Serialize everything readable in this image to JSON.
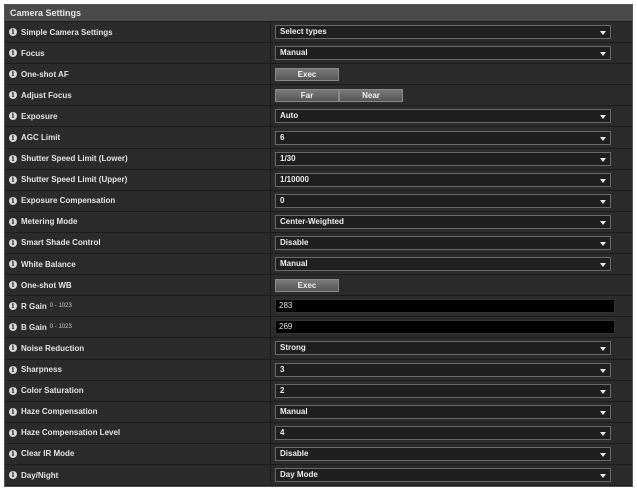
{
  "panel": {
    "title": "Camera Settings"
  },
  "rows": [
    {
      "label": "Simple Camera Settings",
      "control": "select",
      "value": "Select types"
    },
    {
      "label": "Focus",
      "control": "select",
      "value": "Manual"
    },
    {
      "label": "One-shot AF",
      "control": "button",
      "buttons": [
        "Exec"
      ]
    },
    {
      "label": "Adjust Focus",
      "control": "button",
      "buttons": [
        "Far",
        "Near"
      ]
    },
    {
      "label": "Exposure",
      "control": "select",
      "value": "Auto"
    },
    {
      "label": "AGC Limit",
      "control": "select",
      "value": "6"
    },
    {
      "label": "Shutter Speed Limit (Lower)",
      "control": "select",
      "value": "1/30"
    },
    {
      "label": "Shutter Speed Limit (Upper)",
      "control": "select",
      "value": "1/10000"
    },
    {
      "label": "Exposure Compensation",
      "control": "select",
      "value": "0"
    },
    {
      "label": "Metering Mode",
      "control": "select",
      "value": "Center-Weighted"
    },
    {
      "label": "Smart Shade Control",
      "control": "select",
      "value": "Disable"
    },
    {
      "label": "White Balance",
      "control": "select",
      "value": "Manual"
    },
    {
      "label": "One-shot WB",
      "control": "button",
      "buttons": [
        "Exec"
      ]
    },
    {
      "label": "R Gain",
      "range": "0 - 1023",
      "control": "text",
      "value": "283"
    },
    {
      "label": "B Gain",
      "range": "0 - 1023",
      "control": "text",
      "value": "269"
    },
    {
      "label": "Noise Reduction",
      "control": "select",
      "value": "Strong"
    },
    {
      "label": "Sharpness",
      "control": "select",
      "value": "3"
    },
    {
      "label": "Color Saturation",
      "control": "select",
      "value": "2"
    },
    {
      "label": "Haze Compensation",
      "control": "select",
      "value": "Manual"
    },
    {
      "label": "Haze Compensation Level",
      "control": "select",
      "value": "4"
    },
    {
      "label": "Clear IR Mode",
      "control": "select",
      "value": "Disable"
    },
    {
      "label": "Day/Night",
      "control": "select",
      "value": "Day Mode"
    }
  ],
  "icons": {
    "info": "info-icon",
    "dropdown": "chevron-down-icon"
  },
  "colors": {
    "panel_bg": "#2b2b2b",
    "title_bar": "#4a4a4a",
    "text": "#e4e4e4",
    "input_bg": "#000000"
  }
}
